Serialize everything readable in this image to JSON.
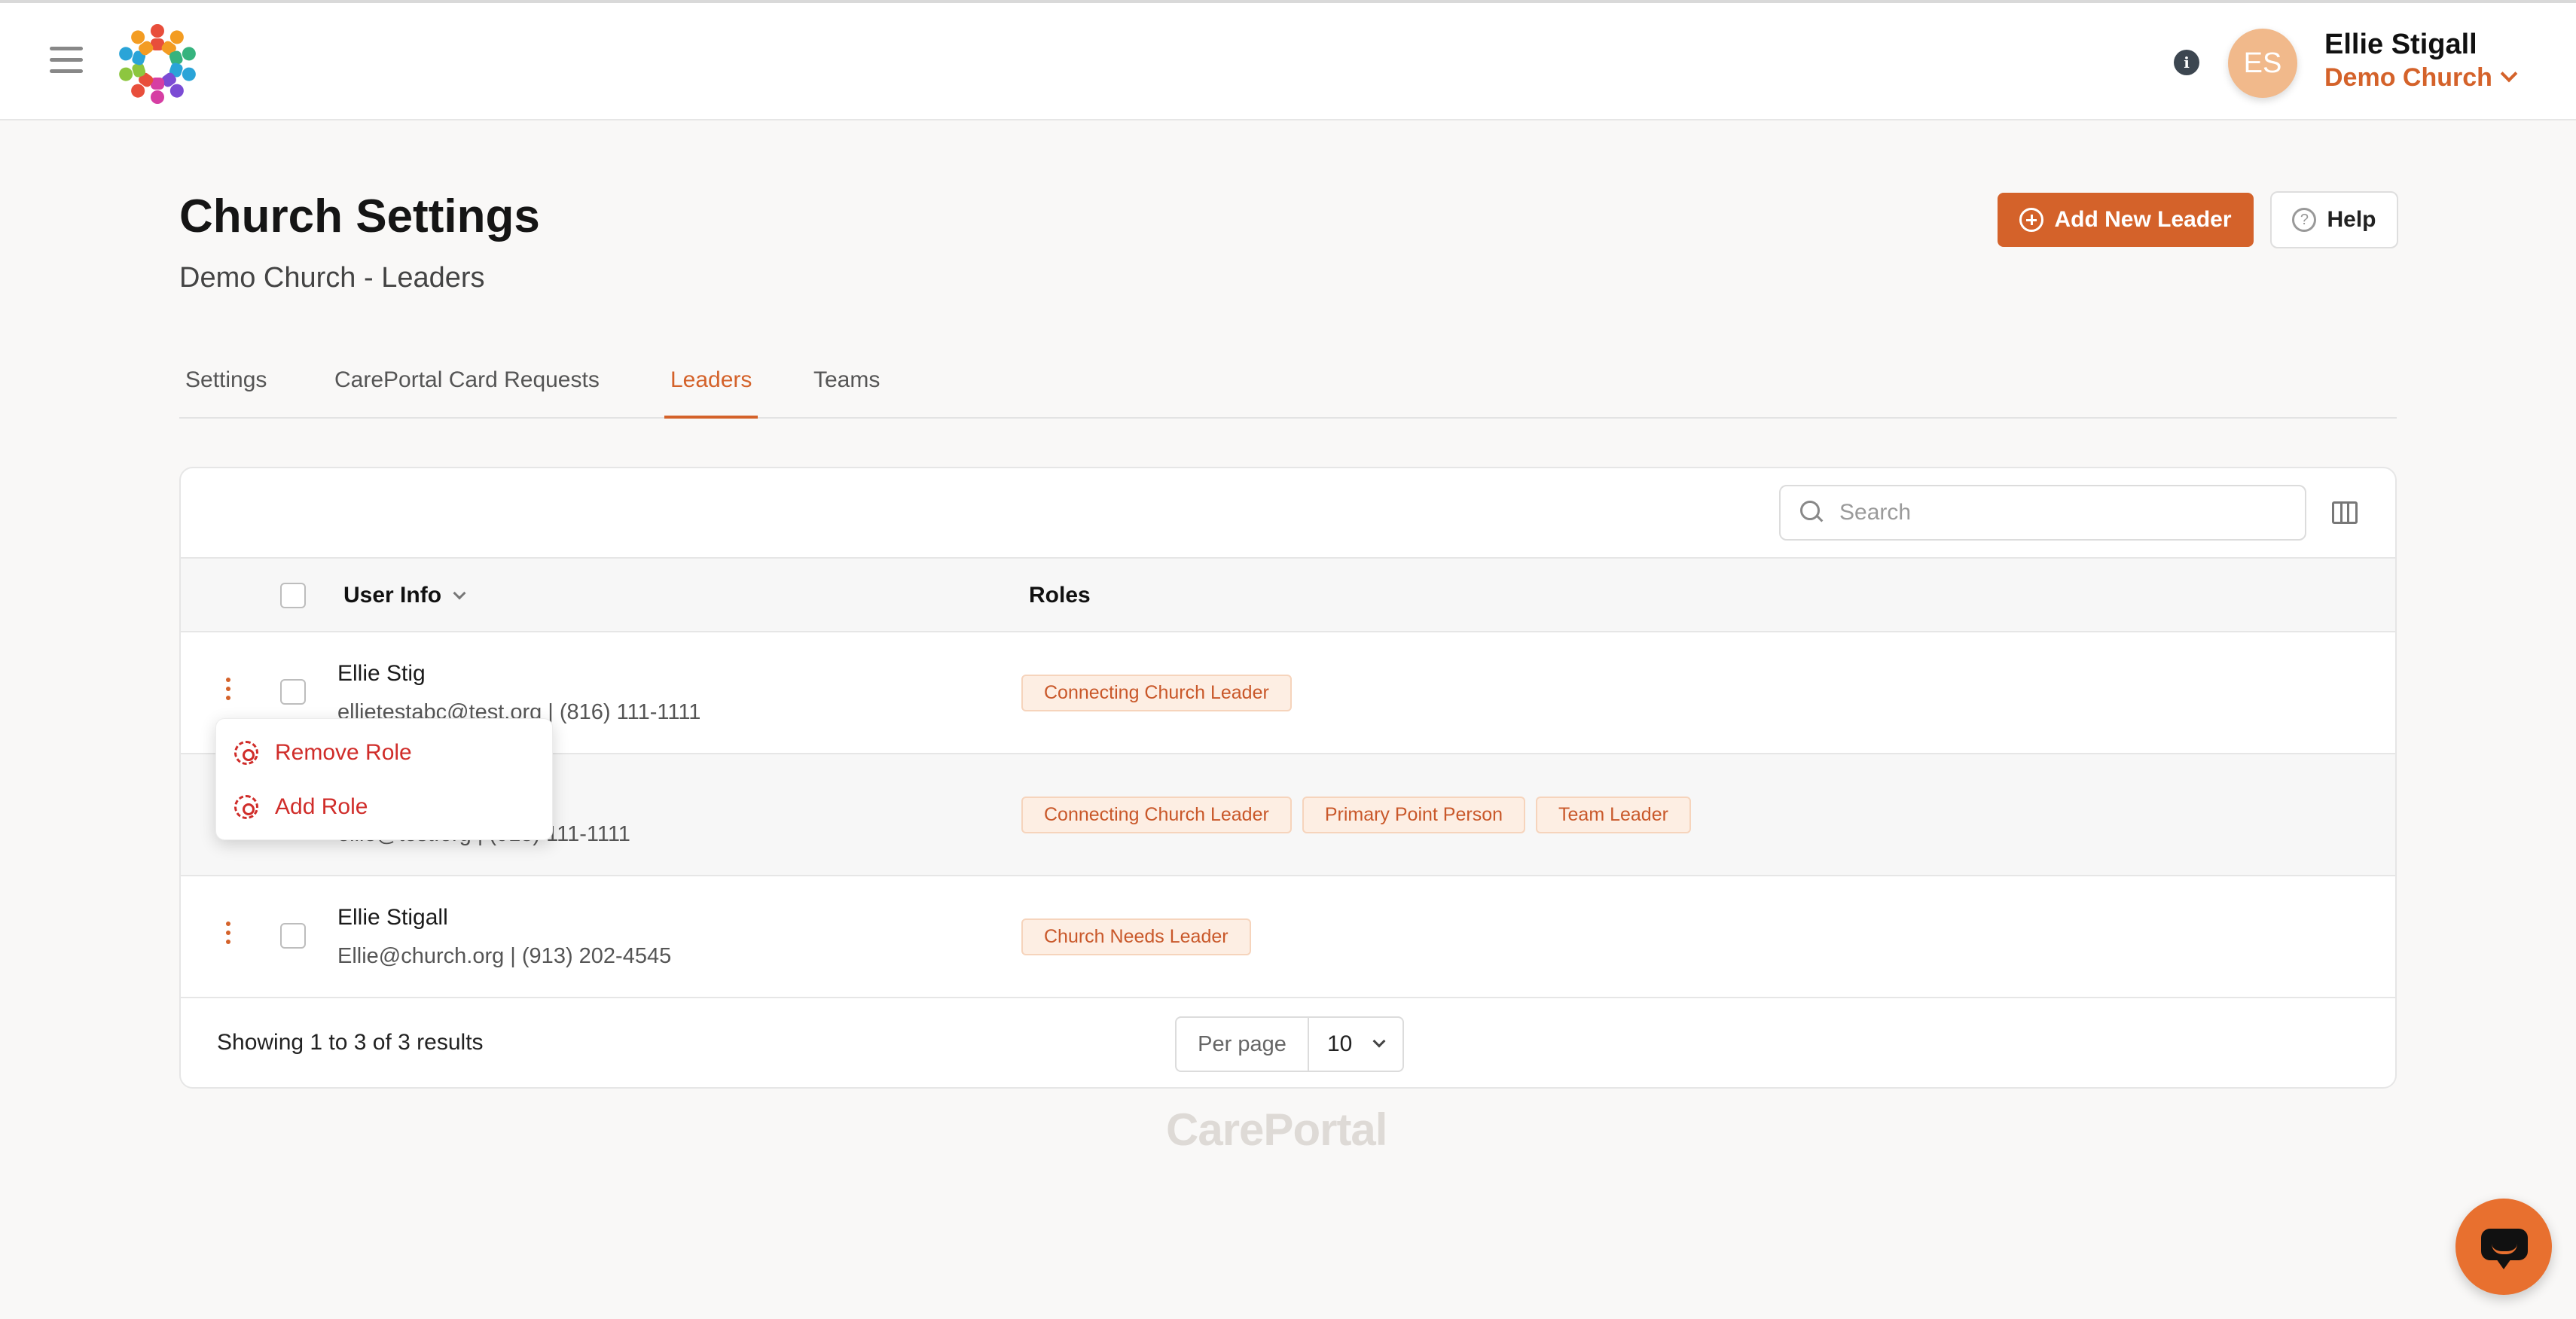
{
  "header": {
    "user_name": "Ellie Stigall",
    "church_name": "Demo Church",
    "avatar_initials": "ES",
    "info_label": "i"
  },
  "page": {
    "title": "Church Settings",
    "subtitle": "Demo Church - Leaders",
    "add_button_label": "Add New Leader",
    "help_button_label": "Help"
  },
  "tabs": [
    {
      "label": "Settings",
      "active": false
    },
    {
      "label": "CarePortal Card Requests",
      "active": false
    },
    {
      "label": "Leaders",
      "active": true
    },
    {
      "label": "Teams",
      "active": false
    }
  ],
  "table": {
    "search_placeholder": "Search",
    "columns": [
      "User Info",
      "Roles"
    ],
    "rows": [
      {
        "name": "Ellie Stig",
        "contact": "ellietestabc@test.org | (816) 111-1111",
        "roles": [
          "Connecting Church Leader"
        ]
      },
      {
        "name": "",
        "contact": "ellie@test.org | (913) 111-1111",
        "roles": [
          "Connecting Church Leader",
          "Primary Point Person",
          "Team Leader"
        ]
      },
      {
        "name": "Ellie Stigall",
        "contact": "Ellie@church.org | (913) 202-4545",
        "roles": [
          "Church Needs Leader"
        ]
      }
    ],
    "results_text": "Showing 1 to 3 of 3 results",
    "per_page_label": "Per page",
    "per_page_value": "10"
  },
  "row_menu": {
    "items": [
      "Remove Role",
      "Add Role"
    ]
  },
  "footer": {
    "brand": "CarePortal"
  },
  "colors": {
    "accent": "#d4622a",
    "menu_text": "#d02d2a",
    "tag_bg": "#fdeee3"
  },
  "icons": {
    "menu": "hamburger-icon",
    "info": "info-icon",
    "search": "search-icon",
    "columns": "columns-icon",
    "help": "question-circle-icon",
    "add": "plus-circle-icon",
    "row_actions": "kebab-icon",
    "menu_items": "gear-icon",
    "chat": "chat-icon"
  }
}
